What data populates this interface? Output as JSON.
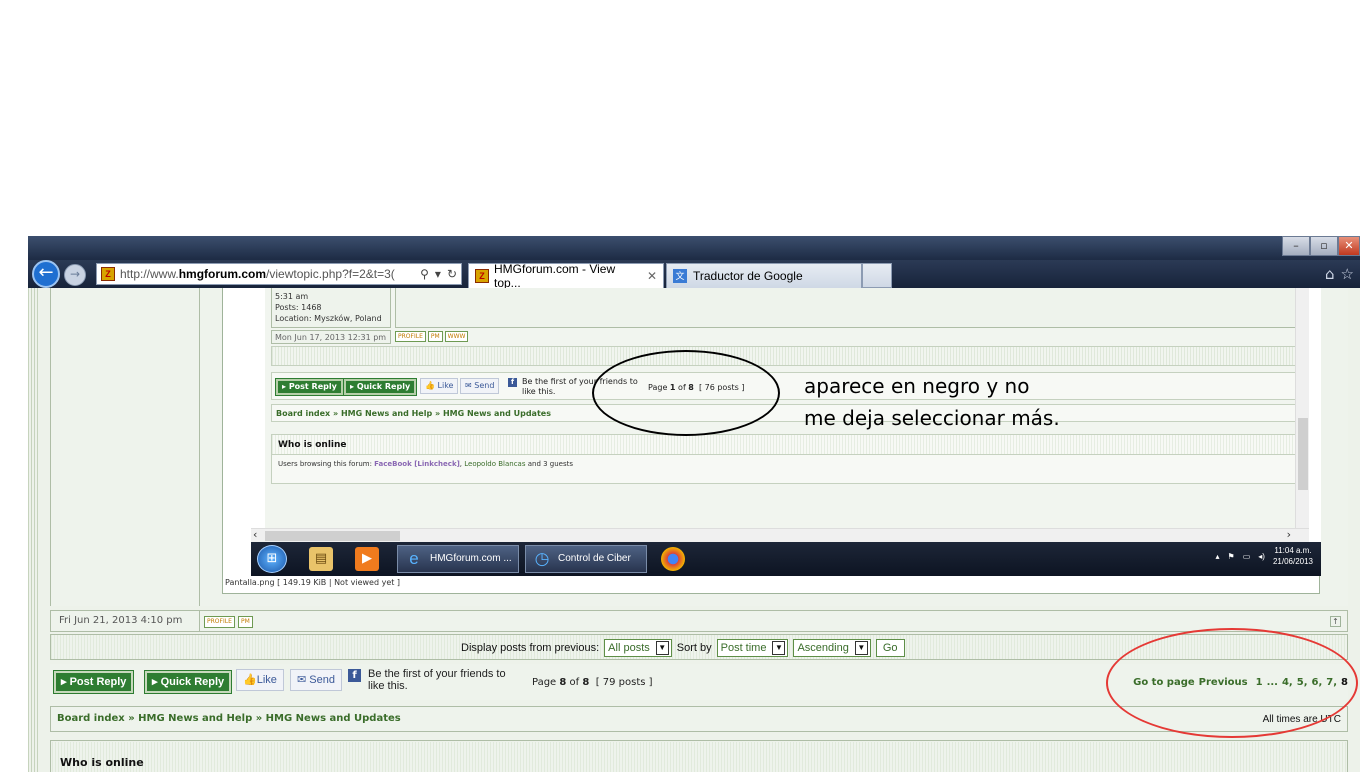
{
  "browser": {
    "address_prefix": "http://www.",
    "address_domain": "hmgforum.com",
    "address_path": "/viewtopic.php?f=2&t=3(",
    "tabs": [
      {
        "label": "HMGforum.com - View top..."
      },
      {
        "label": "Traductor de Google"
      }
    ],
    "window_buttons": [
      "–",
      "▫",
      "✕"
    ]
  },
  "inner_screenshot": {
    "profile_lines": [
      "5:31 am",
      "Posts: 1468",
      "Location: Myszków, Poland"
    ],
    "post_date": "Mon Jun 17, 2013 12:31 pm",
    "mini_buttons": [
      "PROFILE",
      "PM",
      "WWW"
    ],
    "post_reply": "Post Reply",
    "quick_reply": "Quick Reply",
    "like": "Like",
    "send": "Send",
    "fb_text_1": "Be the first of your friends to",
    "fb_text_2": "like this.",
    "page_prefix": "Page ",
    "page_current": "1",
    "page_of": " of ",
    "page_total": "8",
    "posts_count": "[ 76 posts ]",
    "breadcrumb": "Board index » HMG News and Help » HMG News and Updates",
    "who_is_online": "Who is online",
    "users_prefix": "Users browsing this forum: ",
    "user1": "FaceBook [Linkcheck]",
    "user2": "Leopoldo Blancas",
    "users_suffix": " and 3 guests",
    "taskbar_tasks": [
      "HMGforum.com ...",
      "Control de Ciber ..."
    ],
    "clock_time": "11:04 a.m.",
    "clock_date": "21/06/2013"
  },
  "attachment_caption": "Pantalla.png [ 149.19 KiB | Not viewed yet ]",
  "post_footer": {
    "date": "Fri Jun 21, 2013 4:10 pm",
    "buttons": [
      "PROFILE",
      "PM"
    ]
  },
  "display_bar": {
    "label": "Display posts from previous:",
    "period": "All posts",
    "sort_label": "Sort by",
    "sort_field": "Post time",
    "order": "Ascending",
    "go": "Go"
  },
  "action_bar": {
    "post_reply": "Post Reply",
    "quick_reply": "Quick Reply",
    "like": "Like",
    "send": "Send",
    "fb_text_1": "Be the first of your friends to",
    "fb_text_2": "like this.",
    "page_prefix": "Page ",
    "page_current": "8",
    "page_of": " of ",
    "page_total": "8",
    "posts_count": "[ 79 posts ]",
    "goto_label": "Go to page",
    "goto_prev": "Previous",
    "goto_pages": [
      "1",
      "...",
      "4,",
      "5,",
      "6,",
      "7,"
    ],
    "goto_current": "8"
  },
  "breadcrumb": "Board index » HMG News and Help » HMG News and Updates",
  "times_note": "All times are UTC",
  "who_is_online": "Who is online",
  "annotation": {
    "line1": "aparece en negro y no",
    "line2": "me deja seleccionar más."
  }
}
